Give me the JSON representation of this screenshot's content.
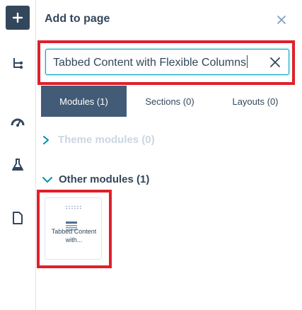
{
  "panel": {
    "title": "Add to page"
  },
  "search": {
    "value": "Tabbed Content with Flexible Columns"
  },
  "tabs": [
    {
      "label": "Modules (1)",
      "active": true
    },
    {
      "label": "Sections (0)",
      "active": false
    },
    {
      "label": "Layouts (0)",
      "active": false
    }
  ],
  "groups": {
    "theme": {
      "label": "Theme modules (0)",
      "expanded": false
    },
    "other": {
      "label": "Other modules (1)",
      "expanded": true
    }
  },
  "module_card": {
    "label": "Tabbed Content with..."
  },
  "rail_icons": [
    "plus-icon",
    "tree-icon",
    "gauge-icon",
    "flask-icon",
    "page-icon"
  ],
  "colors": {
    "rail_add_bg": "#33475b",
    "active_tab_bg": "#425b76",
    "focus_border": "#00a4bd",
    "highlight_outline": "#e0202b",
    "text": "#33475b",
    "muted": "#cbd6e2"
  }
}
